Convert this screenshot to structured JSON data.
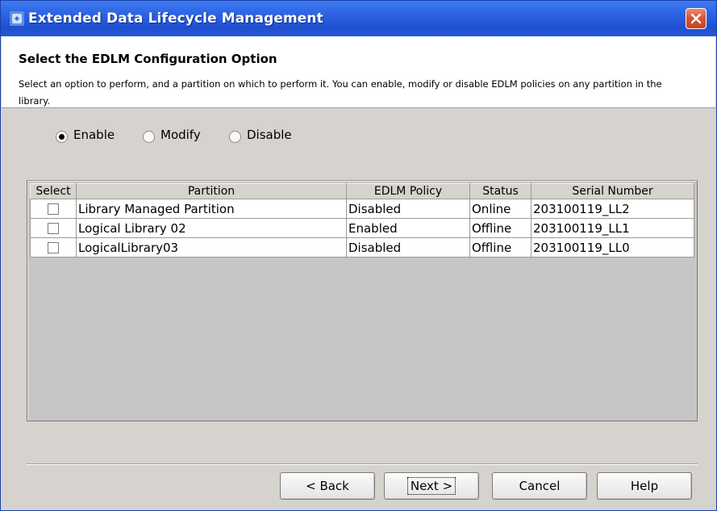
{
  "window": {
    "title": "Extended Data Lifecycle Management",
    "icon": "app-logo-icon",
    "close_icon": "close-icon",
    "titlebar_color": "#2a5fe0",
    "close_color": "#d6532f"
  },
  "header": {
    "heading": "Select the EDLM Configuration Option",
    "description": "Select an option to perform, and a partition on which to perform it. You can enable, modify or disable EDLM policies on any partition in the library."
  },
  "options": [
    {
      "label": "Enable",
      "selected": true
    },
    {
      "label": "Modify",
      "selected": false
    },
    {
      "label": "Disable",
      "selected": false
    }
  ],
  "table": {
    "columns": [
      "Select",
      "Partition",
      "EDLM Policy",
      "Status",
      "Serial Number"
    ],
    "rows": [
      {
        "checked": false,
        "partition": "Library Managed Partition",
        "policy": "Disabled",
        "status": "Online",
        "serial": "203100119_LL2"
      },
      {
        "checked": false,
        "partition": "Logical Library 02",
        "policy": "Enabled",
        "status": "Offline",
        "serial": "203100119_LL1"
      },
      {
        "checked": false,
        "partition": "LogicalLibrary03",
        "policy": "Disabled",
        "status": "Offline",
        "serial": "203100119_LL0"
      }
    ]
  },
  "buttons": {
    "back": "< Back",
    "next": "Next >",
    "cancel": "Cancel",
    "help": "Help"
  }
}
